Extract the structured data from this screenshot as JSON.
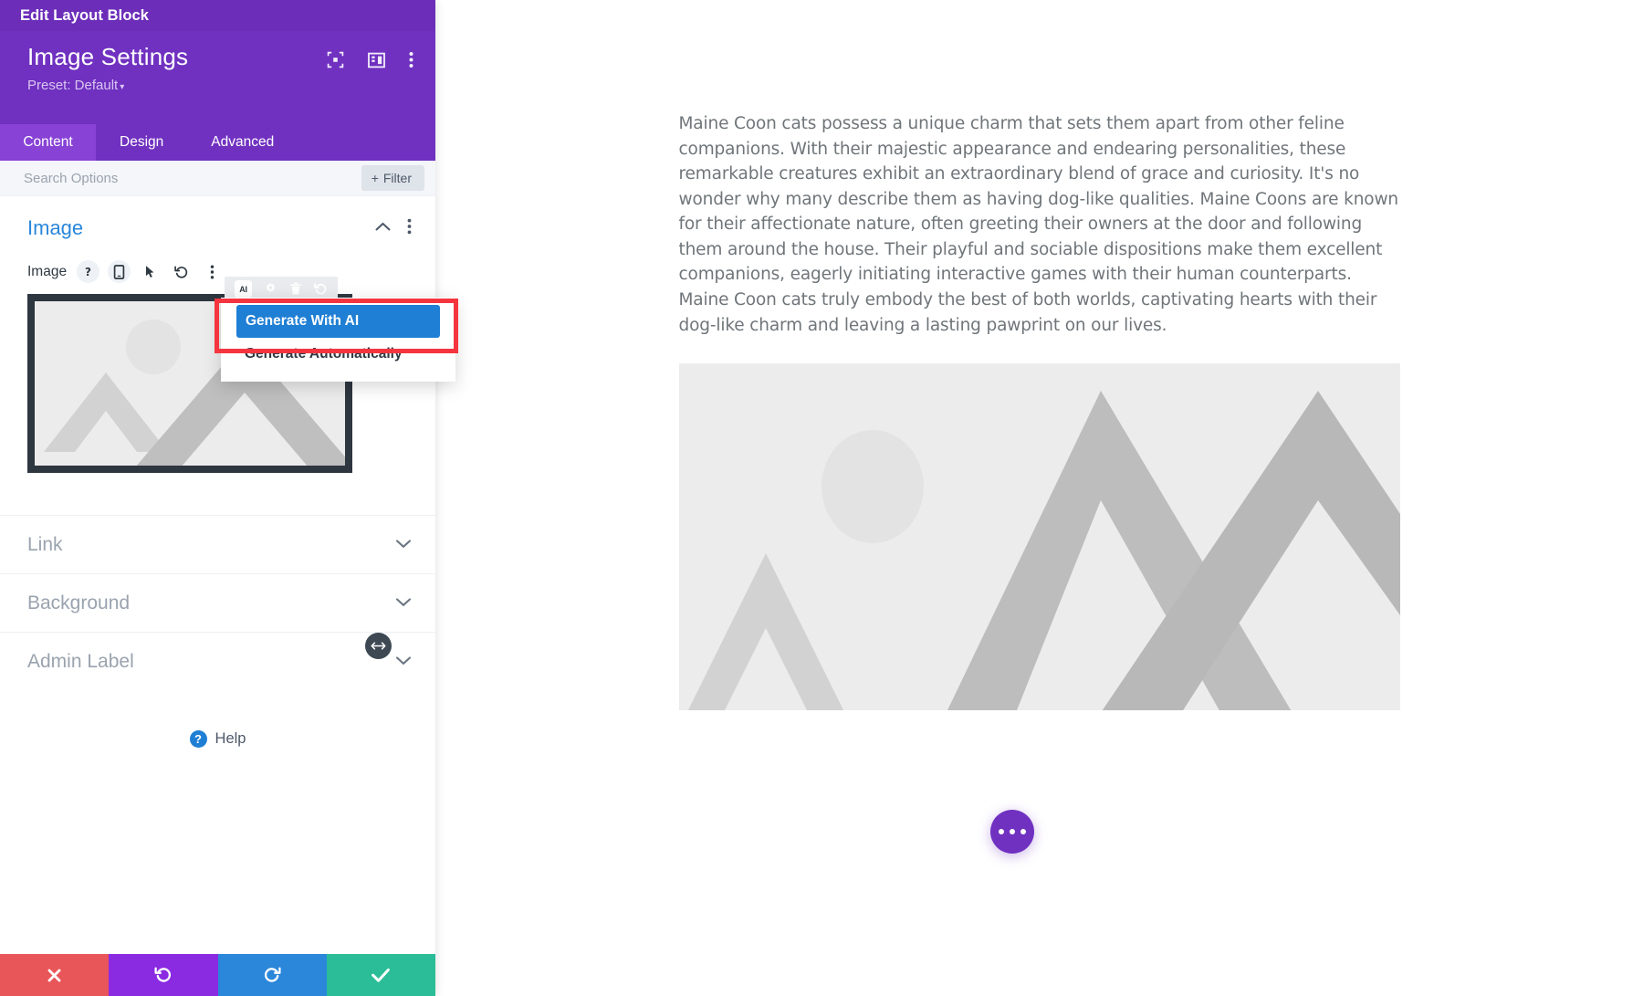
{
  "panel": {
    "topbar_title": "Edit Layout Block",
    "module_title": "Image Settings",
    "preset_label": "Preset: Default",
    "preset_caret": "▾",
    "head_icons": [
      {
        "name": "focus-mode-icon"
      },
      {
        "name": "panel-layout-icon"
      },
      {
        "name": "more-options-icon"
      }
    ],
    "tabs": [
      {
        "label": "Content",
        "active": true
      },
      {
        "label": "Design",
        "active": false
      },
      {
        "label": "Advanced",
        "active": false
      }
    ],
    "search": {
      "placeholder": "Search Options",
      "value": "",
      "filter_label": "Filter",
      "filter_plus": "+"
    },
    "section": {
      "title": "Image",
      "field_label": "Image",
      "field_icons": [
        "help-icon",
        "responsive-icon",
        "hover-icon",
        "reset-icon",
        "kebab-icon"
      ]
    },
    "accordions": [
      {
        "label": "Link"
      },
      {
        "label": "Background"
      },
      {
        "label": "Admin Label"
      }
    ],
    "help": {
      "badge": "?",
      "label": "Help"
    },
    "footer_buttons": [
      {
        "name": "discard-button",
        "icon": "close-icon",
        "color": "#e8565a"
      },
      {
        "name": "undo-button",
        "icon": "undo-icon",
        "color": "#8a2be2"
      },
      {
        "name": "redo-button",
        "icon": "redo-icon",
        "color": "#2b87da"
      },
      {
        "name": "save-button",
        "icon": "check-icon",
        "color": "#2bbd97"
      }
    ]
  },
  "ai_toolbar": {
    "items": [
      {
        "name": "ai-icon",
        "label": "AI"
      },
      {
        "name": "settings-gear-icon",
        "label": ""
      },
      {
        "name": "trash-icon",
        "label": ""
      },
      {
        "name": "reset-icon",
        "label": ""
      }
    ]
  },
  "dropdown": {
    "items": [
      {
        "label": "Generate With AI",
        "selected": true
      },
      {
        "label": "Generate Automatically",
        "selected": false
      }
    ],
    "highlight_color": "#f4353f",
    "selected_color": "#1f7fd4"
  },
  "canvas": {
    "paragraph": "Maine Coon cats possess a unique charm that sets them apart from other feline companions. With their majestic appearance and endearing personalities, these remarkable creatures exhibit an extraordinary blend of grace and curiosity. It's no wonder why many describe them as having dog-like qualities. Maine Coons are known for their affectionate nature, often greeting their owners at the door and following them around the house. Their playful and sociable dispositions make them excellent companions, eagerly initiating interactive games with their human counterparts. Maine Coon cats truly embody the best of both worlds, captivating hearts with their dog-like charm and leaving a lasting pawprint on our lives.",
    "image_placeholder_name": "image-placeholder",
    "fab_name": "floating-options-button"
  },
  "colors": {
    "brand_purple": "#7031c0",
    "topbar_purple": "#6c2eb9",
    "tab_active": "#8842d6",
    "section_blue": "#2b87da",
    "placeholder_gray": "#ececec"
  }
}
